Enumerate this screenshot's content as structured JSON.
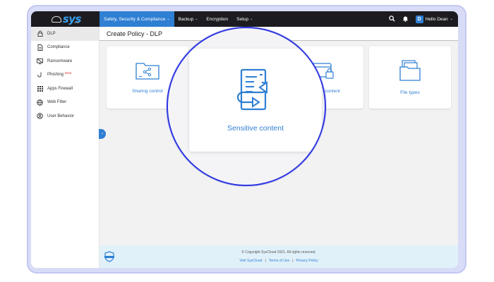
{
  "brand": {
    "logo_text": "sys",
    "logo_sub": "cloud"
  },
  "nav": {
    "items": [
      {
        "label": "Safety, Security & Compliance",
        "active": true,
        "dropdown": true
      },
      {
        "label": "Backup",
        "dropdown": true
      },
      {
        "label": "Encryption",
        "dropdown": false
      },
      {
        "label": "Setup",
        "dropdown": true
      }
    ]
  },
  "topbar": {
    "user_initial": "D",
    "user_label": "Hello Dean",
    "search_icon": "search-icon",
    "bell_icon": "bell-icon"
  },
  "sidebar": {
    "items": [
      {
        "label": "DLP",
        "icon": "lock-icon",
        "active": true
      },
      {
        "label": "Compliance",
        "icon": "document-icon"
      },
      {
        "label": "Ransomware",
        "icon": "ransomware-icon"
      },
      {
        "label": "Phishing",
        "icon": "hook-icon",
        "badge": "Beta"
      },
      {
        "label": "Apps Firewall",
        "icon": "grid-icon"
      },
      {
        "label": "Web Filter",
        "icon": "globe-icon"
      },
      {
        "label": "User Behavior",
        "icon": "user-circle-icon"
      }
    ]
  },
  "page": {
    "title": "Create Policy - DLP"
  },
  "cards": [
    {
      "label": "Sharing control",
      "icon": "share-folder-icon"
    },
    {
      "label": "",
      "icon": ""
    },
    {
      "label": "Sensitive content",
      "icon": "credit-card-lock-icon"
    },
    {
      "label": "File types",
      "icon": "files-icon"
    }
  ],
  "magnified": {
    "label": "Sensitive content",
    "icon": "sensitive-content-icon"
  },
  "footer": {
    "copyright": "© Copyright SysCloud 2021. All rights reserved.",
    "links": [
      "Visit SysCloud",
      "Terms of Use",
      "Privacy Policy"
    ],
    "separator": "|"
  },
  "colors": {
    "accent": "#2f7fd3",
    "topbar": "#1c1c20",
    "magnifier_ring": "#2d36e0",
    "frame": "#d9dcf7"
  }
}
